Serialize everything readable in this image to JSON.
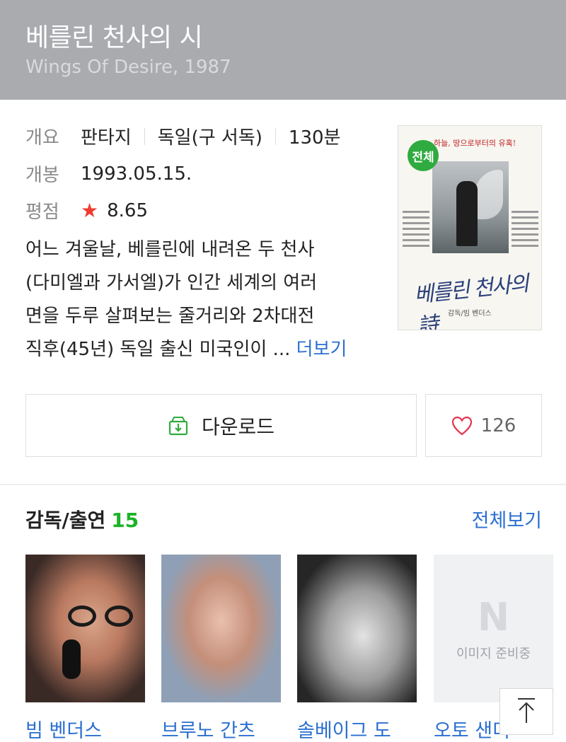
{
  "header": {
    "title": "베를린 천사의 시",
    "subtitle": "Wings Of Desire, 1987"
  },
  "info": {
    "overview_label": "개요",
    "genre": "판타지",
    "country": "독일(구 서독)",
    "runtime": "130분",
    "release_label": "개봉",
    "release_date": "1993.05.15.",
    "rating_label": "평점",
    "rating": "8.65"
  },
  "synopsis": {
    "lines": [
      "어느 겨울날, 베를린에 내려온 두 천사",
      "(다미엘과 가서엘)가 인간 세계의 여러",
      "면을 두루 살펴보는 줄거리와 2차대전",
      "직후(45년) 독일 출신 미국인이 ..."
    ],
    "more_label": "더보기"
  },
  "poster": {
    "age_badge": "전체",
    "tagline": "하늘, 땅으로부터의 유혹!",
    "calligraphy": "베를린 천사의 詩",
    "credit": "감독/빔 벤더스",
    "badge_color": "#2fab3f"
  },
  "actions": {
    "download_label": "다운로드",
    "like_count": "126"
  },
  "cast": {
    "heading": "감독/출연",
    "count": "15",
    "view_all": "전체보기",
    "members": [
      {
        "name": "빔 벤더스"
      },
      {
        "name": "브루노 간츠"
      },
      {
        "name": "솔베이그 도"
      },
      {
        "name": "오토 샌더",
        "placeholder_letter": "N",
        "placeholder_text": "이미지 준비중"
      }
    ]
  },
  "colors": {
    "header_bg": "#a9abaf",
    "link_blue": "#2b6fd1",
    "count_green": "#1bb327",
    "star_red": "#f03c2e"
  },
  "icons": {
    "star": "star-icon",
    "download": "download-icon",
    "heart": "heart-icon",
    "scroll_top": "arrow-up-icon"
  }
}
